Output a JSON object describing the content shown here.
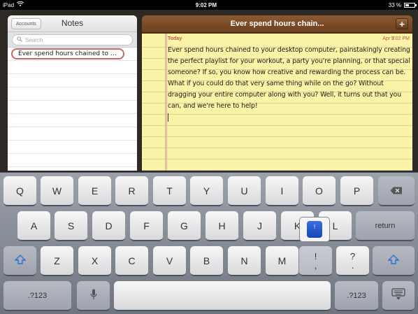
{
  "statusbar": {
    "carrier": "iPad",
    "time": "9:02 PM",
    "battery": "33 %"
  },
  "sidebar": {
    "accounts_label": "Accounts",
    "title": "Notes",
    "search_placeholder": "Search",
    "notes": [
      {
        "title": "Ever spend hours chained to your desktop computer, painstakingly creating"
      }
    ]
  },
  "note": {
    "header_title": "Ever spend hours chain...",
    "add_label": "+",
    "today_label": "Today",
    "date": "Apr 7",
    "time": "9:02 PM",
    "body": "Ever spend hours chained to your desktop computer, painstakingly creating the perfect playlist for your workout, a party you're planning, or that special someone? If so, you know how creative and rewarding the process can be. What if you could do that very same thing while on the go? Without dragging your entire computer along with you? Well, it turns out that you can, and we're here to help!"
  },
  "keyboard": {
    "row1": [
      "Q",
      "W",
      "E",
      "R",
      "T",
      "Y",
      "U",
      "I",
      "O",
      "P"
    ],
    "row2": [
      "A",
      "S",
      "D",
      "F",
      "G",
      "H",
      "J",
      "K",
      "L"
    ],
    "row3": [
      "Z",
      "X",
      "C",
      "V",
      "B",
      "N",
      "M"
    ],
    "return_label": "return",
    "numbers_label": ".?123",
    "exclaim_top": "!",
    "exclaim_bottom": ",",
    "question_top": "?",
    "question_bottom": ".",
    "popup_label": "!"
  }
}
